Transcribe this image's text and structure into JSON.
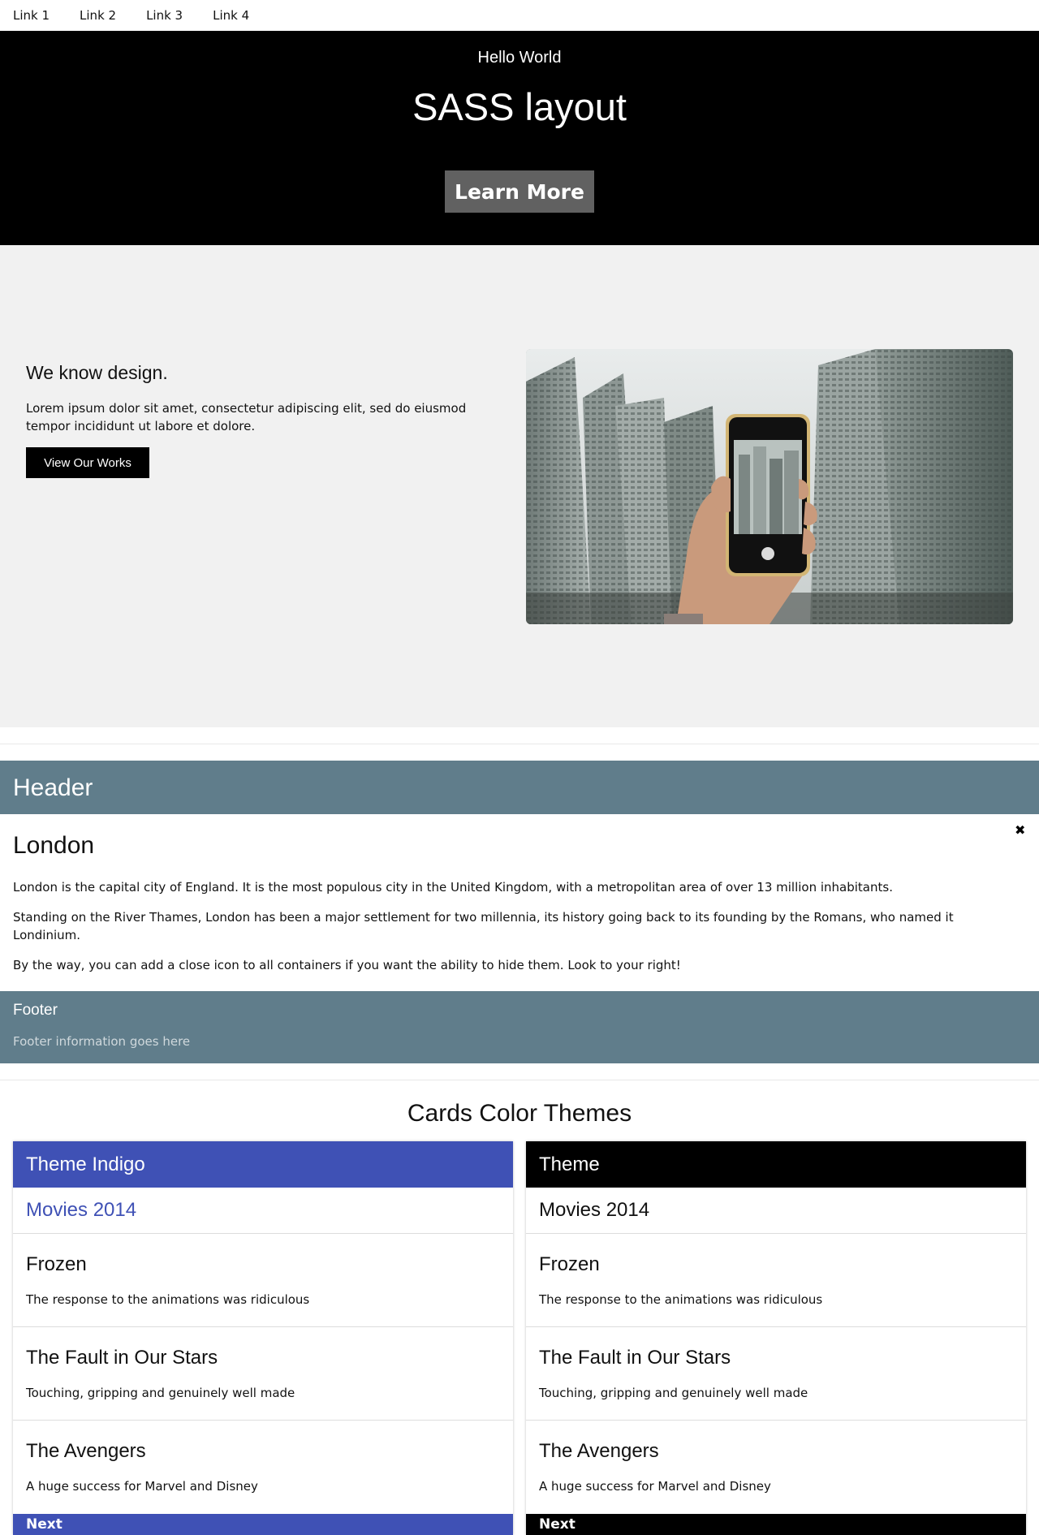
{
  "nav": {
    "links": [
      "Link 1",
      "Link 2",
      "Link 3",
      "Link 4"
    ]
  },
  "hero": {
    "greeting": "Hello World",
    "title": "SASS layout",
    "button_label": "Learn More"
  },
  "design": {
    "heading": "We know design.",
    "text": "Lorem ipsum dolor sit amet, consectetur adipiscing elit, sed do eiusmod tempor incididunt ut labore et dolore.",
    "button_label": "View Our Works"
  },
  "panel": {
    "header": "Header",
    "title": "London",
    "close_icon": "close-icon",
    "paragraphs": [
      "London is the capital city of England. It is the most populous city in the United Kingdom, with a metropolitan area of over 13 million inhabitants.",
      "Standing on the River Thames, London has been a major settlement for two millennia, its history going back to its founding by the Romans, who named it Londinium.",
      "By the way, you can add a close icon to all containers if you want the ability to hide them. Look to your right!"
    ],
    "footer_title": "Footer",
    "footer_text": "Footer information goes here"
  },
  "cards": {
    "title": "Cards Color Themes",
    "list": [
      {
        "theme": "Theme Indigo",
        "accent": "#3f51b5",
        "subtitle": "Movies 2014",
        "items": [
          {
            "title": "Frozen",
            "desc": "The response to the animations was ridiculous"
          },
          {
            "title": "The Fault in Our Stars",
            "desc": "Touching, gripping and genuinely well made"
          },
          {
            "title": "The Avengers",
            "desc": "A huge success for Marvel and Disney"
          }
        ],
        "next_label": "Next"
      },
      {
        "theme": "Theme",
        "accent": "#000000",
        "subtitle": "Movies 2014",
        "items": [
          {
            "title": "Frozen",
            "desc": "The response to the animations was ridiculous"
          },
          {
            "title": "The Fault in Our Stars",
            "desc": "Touching, gripping and genuinely well made"
          },
          {
            "title": "The Avengers",
            "desc": "A huge success for Marvel and Disney"
          }
        ],
        "next_label": "Next"
      }
    ]
  }
}
